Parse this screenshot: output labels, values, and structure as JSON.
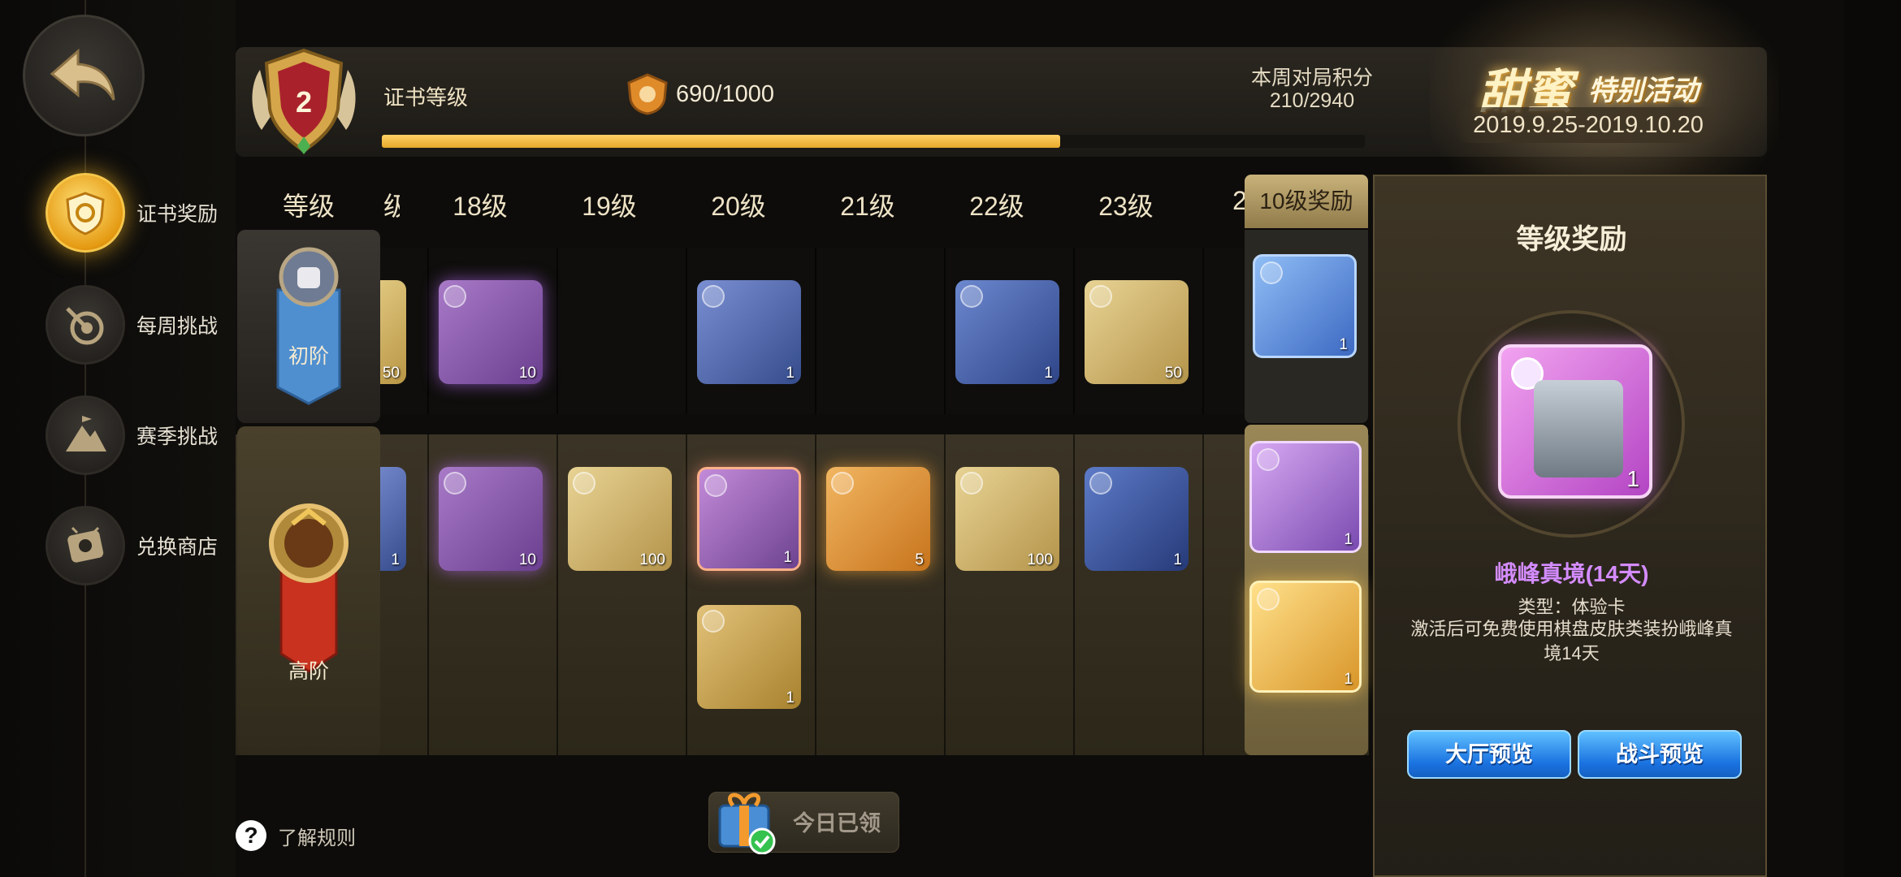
{
  "sidebar": {
    "back_icon": "back-arrow-icon",
    "items": [
      {
        "label": "证书奖励",
        "icon": "shield-badge-icon",
        "active": true
      },
      {
        "label": "每周挑战",
        "icon": "target-dart-icon",
        "active": false
      },
      {
        "label": "赛季挑战",
        "icon": "mountain-flag-icon",
        "active": false
      },
      {
        "label": "兑换商店",
        "icon": "shop-ticket-icon",
        "active": false
      }
    ]
  },
  "header": {
    "rank_level": "2",
    "cert_label": "证书等级",
    "score": "690/1000",
    "progress_fraction": 0.69,
    "weekly_label": "本周对局积分",
    "weekly_value": "210/2940"
  },
  "event": {
    "title": "甜蜜",
    "subtitle": "特别活动",
    "dates": "2019.9.25-2019.10.20"
  },
  "grid": {
    "tier_header": "等级",
    "partial_left_glyph": "级",
    "partial_right_glyph": "2",
    "levels": [
      "18级",
      "19级",
      "20级",
      "21级",
      "22级",
      "23级"
    ],
    "free_tier_label": "初阶",
    "premium_tier_label": "高阶",
    "free_row": [
      "50",
      "10",
      "",
      "1",
      "",
      "1",
      "50"
    ],
    "premium_row": [
      "1",
      "10",
      "100",
      "1",
      "5",
      "100",
      "1"
    ],
    "premium_row2_count": "1"
  },
  "reward10": {
    "header": "10级奖励",
    "free_count": "1",
    "premium_counts": [
      "1",
      "1"
    ]
  },
  "detail": {
    "title": "等级奖励",
    "item_count": "1",
    "name": "峨峰真境(14天)",
    "type": "类型：体验卡",
    "description": "激活后可免费使用棋盘皮肤类装扮峨峰真境14天",
    "lobby_button": "大厅预览",
    "battle_button": "战斗预览"
  },
  "footer": {
    "rules_icon": "?",
    "rules_label": "了解规则",
    "claim_label": "今日已领"
  },
  "colors": {
    "accent_gold": "#e7a92b",
    "item_purple": "#b445c4",
    "item_blue": "#3d5fa8",
    "item_gold": "#d1ae5a",
    "button_blue": "#1a72e0"
  }
}
